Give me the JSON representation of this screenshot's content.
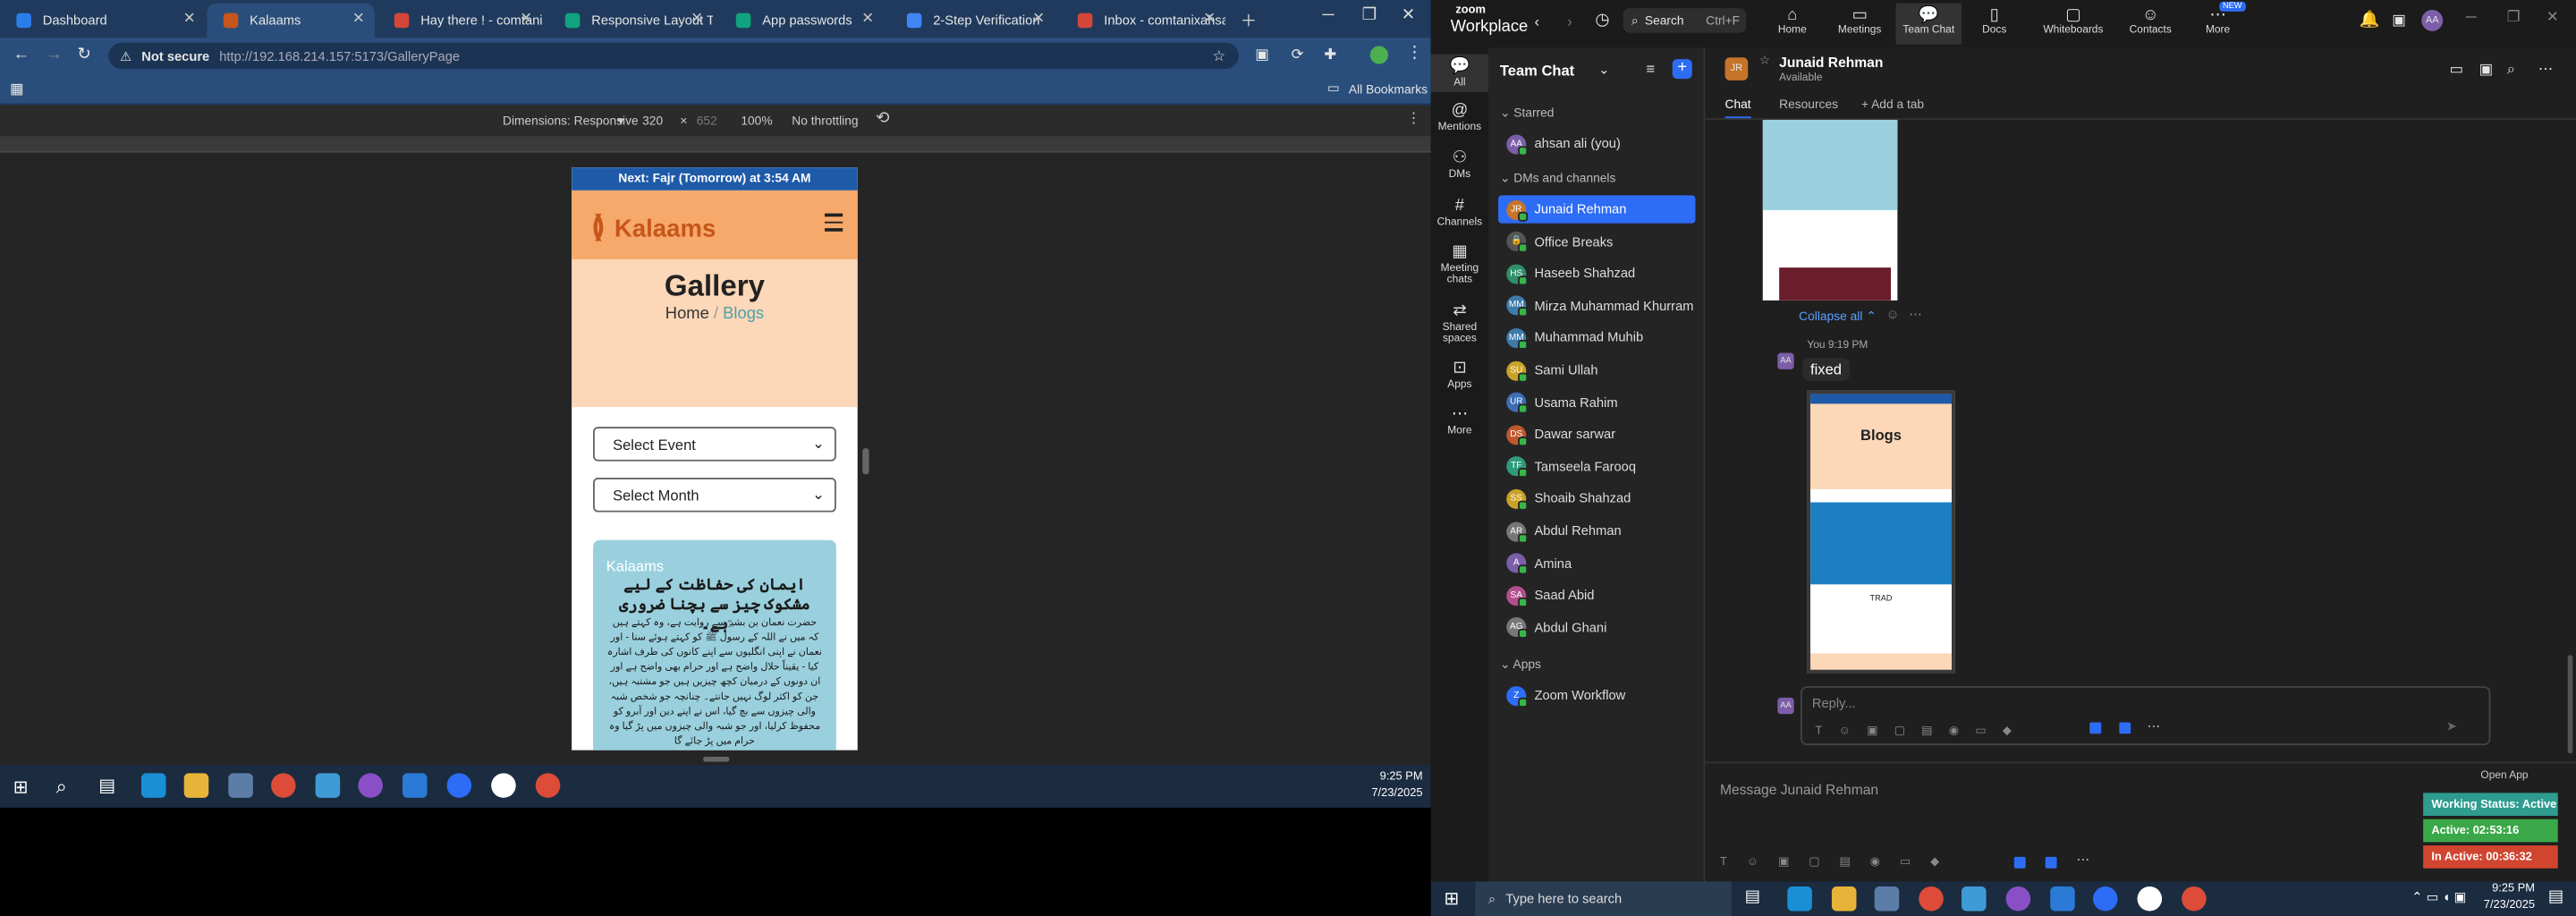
{
  "browser": {
    "tabs": [
      {
        "label": "Dashboard",
        "color": "#2b7de9"
      },
      {
        "label": "Kalaams",
        "color": "#c7561b"
      },
      {
        "label": "Hay there ! - comtani...",
        "color": "#d44638"
      },
      {
        "label": "Responsive Layout Tai...",
        "color": "#10a37f"
      },
      {
        "label": "App passwords",
        "color": "#10a37f"
      },
      {
        "label": "2-Step Verification",
        "color": "#4285f4"
      },
      {
        "label": "Inbox - comtanixahsan...",
        "color": "#d44638"
      }
    ],
    "not_secure": "Not secure",
    "url": "http://192.168.214.157:5173/GalleryPage",
    "all_bookmarks": "All Bookmarks",
    "devtools": {
      "dimensions": "Dimensions: Responsive",
      "width": "320",
      "height": "652",
      "zoom": "100%",
      "throttling": "No throttling"
    }
  },
  "site": {
    "prayer_bar": "Next: Fajr (Tomorrow) at 3:54 AM",
    "logo": "Kalaams",
    "page_title": "Gallery",
    "breadcrumb_home": "Home",
    "breadcrumb_sep": "/",
    "breadcrumb_current": "Blogs",
    "select_event": "Select Event",
    "select_month": "Select Month",
    "card_brand": "Kalaams",
    "card_title_urdu": "ایمان کی حفاظت کے لیے مشکوک چیز سے بچنا ضروری ہے۔",
    "card_body_urdu": "حضرت نعمان بن بشیرؓ سے روایت ہے، وہ کہتے ہیں کہ میں نے اللہ کے رسول ﷺ کو کہتے ہوئے سنا - اور نعمان نے اپنی انگلیوں سے اپنے کانوں کی طرف اشارہ کیا - یقیناً حلال واضح ہے اور حرام بھی واضح ہے اور ان دونوں کے درمیان کچھ چیزیں ہیں جو مشتبہ ہیں، جن کو اکثر لوگ نہیں جانتے۔ چنانچہ جو شخص شبہ والی چیزوں سے بچ گیا، اس نے اپنے دین اور آبرو کو محفوظ کرلیا، اور جو شبہ والی چیزوں میں پڑ گیا وہ حرام میں پڑ جائے گا"
  },
  "taskbar_left": {
    "time": "9:25 PM",
    "date": "7/23/2025"
  },
  "zoom": {
    "brand_top": "zoom",
    "brand": "Workplace",
    "search": "Search",
    "search_shortcut": "Ctrl+F",
    "topnav": [
      "Home",
      "Meetings",
      "Team Chat",
      "Docs",
      "Whiteboards",
      "Contacts",
      "More"
    ],
    "more_badge": "NEW",
    "leftnav": [
      "All",
      "Mentions",
      "DMs",
      "Channels",
      "Meeting chats",
      "Shared spaces",
      "Apps",
      "More"
    ],
    "panel_title": "Team Chat",
    "starred_header": "Starred",
    "starred": [
      {
        "name": "ahsan ali (you)",
        "initials": "AA",
        "color": "#7b5ea7"
      }
    ],
    "dms_header": "DMs and channels",
    "dms": [
      {
        "name": "Junaid Rehman",
        "initials": "JR",
        "color": "#c6742a"
      },
      {
        "name": "Office Breaks",
        "initials": "🔒",
        "color": "#555555"
      },
      {
        "name": "Haseeb Shahzad",
        "initials": "HS",
        "color": "#2f8f6b"
      },
      {
        "name": "Mirza Muhammad Khurram",
        "initials": "MM",
        "color": "#3d7aa8"
      },
      {
        "name": "Muhammad Muhib",
        "initials": "MM",
        "color": "#3d7aa8"
      },
      {
        "name": "Sami Ullah",
        "initials": "SU",
        "color": "#c9a227"
      },
      {
        "name": "Usama Rahim",
        "initials": "UR",
        "color": "#3c6db3"
      },
      {
        "name": "Dawar sarwar",
        "initials": "DS",
        "color": "#c0582e"
      },
      {
        "name": "Tamseela Farooq",
        "initials": "TF",
        "color": "#2f9a7c"
      },
      {
        "name": "Shoaib Shahzad",
        "initials": "SS",
        "color": "#c9a227"
      },
      {
        "name": "Abdul Rehman",
        "initials": "AR",
        "color": "#777777"
      },
      {
        "name": "Amina",
        "initials": "A",
        "color": "#7b5ea7"
      },
      {
        "name": "Saad Abid",
        "initials": "SA",
        "color": "#b34f8d"
      },
      {
        "name": "Abdul Ghani",
        "initials": "AG",
        "color": "#777777"
      }
    ],
    "apps_header": "Apps",
    "apps": [
      {
        "name": "Zoom Workflow",
        "initials": "Z",
        "color": "#2d6cf5"
      }
    ],
    "chat": {
      "contact": "Junaid Rehman",
      "presence": "Available",
      "tabs": [
        "Chat",
        "Resources",
        "Add a tab"
      ],
      "collapse": "Collapse all",
      "sender": "You",
      "time": "9:19 PM",
      "message": "fixed",
      "screenshot_title": "Blogs",
      "screenshot_caption": "TRAD",
      "reply_placeholder": "Reply...",
      "composer_placeholder": "Message Junaid Rehman",
      "open_app": "Open App"
    },
    "status": {
      "working": "Working Status: Active",
      "active": "Active: 02:53:16",
      "inactive": "In Active: 00:36:32"
    }
  },
  "taskbar_right": {
    "search_placeholder": "Type here to search",
    "time": "9:25 PM",
    "date": "7/23/2025"
  }
}
